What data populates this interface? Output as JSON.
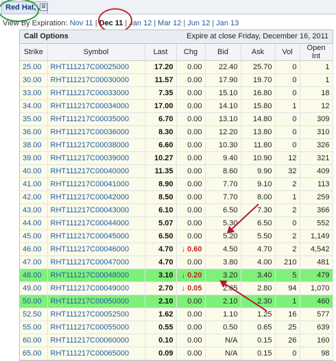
{
  "tab": {
    "label": "Red Hat, ...",
    "close": "⊠"
  },
  "expiration": {
    "label": "View By Expiration:",
    "links": [
      "Nov 11",
      "Dec 11",
      "Jan 12",
      "Mar 12",
      "Jun 12",
      "Jan 13"
    ],
    "current": "Dec 11"
  },
  "table": {
    "title": "Call Options",
    "expire_note": "Expire at close Friday, December 16, 2011",
    "columns": [
      "Strike",
      "Symbol",
      "Last",
      "Chg",
      "Bid",
      "Ask",
      "Vol",
      "Open Int"
    ],
    "rows": [
      [
        "25.00",
        "RHT111217C00025000",
        "17.20",
        "0.00",
        "22.40",
        "25.70",
        "0",
        "1"
      ],
      [
        "30.00",
        "RHT111217C00030000",
        "11.57",
        "0.00",
        "17.90",
        "19.70",
        "0",
        "1"
      ],
      [
        "33.00",
        "RHT111217C00033000",
        "7.35",
        "0.00",
        "15.10",
        "16.80",
        "0",
        "18"
      ],
      [
        "34.00",
        "RHT111217C00034000",
        "17.00",
        "0.00",
        "14.10",
        "15.80",
        "1",
        "12"
      ],
      [
        "35.00",
        "RHT111217C00035000",
        "6.70",
        "0.00",
        "13.10",
        "14.80",
        "0",
        "309"
      ],
      [
        "36.00",
        "RHT111217C00036000",
        "8.30",
        "0.00",
        "12.20",
        "13.80",
        "0",
        "310"
      ],
      [
        "38.00",
        "RHT111217C00038000",
        "6.60",
        "0.00",
        "10.30",
        "11.80",
        "0",
        "326"
      ],
      [
        "39.00",
        "RHT111217C00039000",
        "10.27",
        "0.00",
        "9.40",
        "10.90",
        "12",
        "321"
      ],
      [
        "40.00",
        "RHT111217C00040000",
        "11.35",
        "0.00",
        "8.60",
        "9.90",
        "32",
        "409"
      ],
      [
        "41.00",
        "RHT111217C00041000",
        "8.90",
        "0.00",
        "7.70",
        "9.10",
        "2",
        "113"
      ],
      [
        "42.00",
        "RHT111217C00042000",
        "8.50",
        "0.00",
        "7.70",
        "8.00",
        "1",
        "259"
      ],
      [
        "43.00",
        "RHT111217C00043000",
        "6.10",
        "0.00",
        "6.50",
        "7.30",
        "2",
        "366"
      ],
      [
        "44.00",
        "RHT111217C00044000",
        "5.07",
        "0.00",
        "5.30",
        "6.50",
        "0",
        "552"
      ],
      [
        "45.00",
        "RHT111217C00045000",
        "6.50",
        "0.00",
        "5.20",
        "5.50",
        "2",
        "1,149"
      ],
      [
        "46.00",
        "RHT111217C00046000",
        "4.70",
        "0.60",
        "4.50",
        "4.70",
        "2",
        "4,542"
      ],
      [
        "47.00",
        "RHT111217C00047000",
        "4.70",
        "0.00",
        "3.80",
        "4.00",
        "210",
        "481"
      ],
      [
        "48.00",
        "RHT111217C00048000",
        "3.10",
        "0.20",
        "3.20",
        "3.40",
        "5",
        "479"
      ],
      [
        "49.00",
        "RHT111217C00049000",
        "2.70",
        "0.05",
        "2.65",
        "2.80",
        "94",
        "1,070"
      ],
      [
        "50.00",
        "RHT111217C00050000",
        "2.10",
        "0.00",
        "2.10",
        "2.30",
        "1",
        "460"
      ],
      [
        "52.50",
        "RHT111217C00052500",
        "1.62",
        "0.00",
        "1.10",
        "1.25",
        "16",
        "577"
      ],
      [
        "55.00",
        "RHT111217C00055000",
        "0.55",
        "0.00",
        "0.50",
        "0.65",
        "25",
        "639"
      ],
      [
        "60.00",
        "RHT111217C00060000",
        "0.10",
        "0.00",
        "N/A",
        "0.15",
        "26",
        "160"
      ],
      [
        "65.00",
        "RHT111217C00065000",
        "0.09",
        "0.00",
        "N/A",
        "0.15",
        "0",
        "98"
      ]
    ],
    "down_rows": [
      14,
      16,
      17
    ],
    "highlight_rows": [
      16,
      18
    ],
    "down_glyph": "↓",
    "colors": {
      "highlight": "#7ff07a",
      "row_bg": "#fbfbe9",
      "link": "#1e5aa8",
      "down": "#c01f1f",
      "annotation_red": "#cc2a2a",
      "annotation_green": "#2f9a3a"
    }
  }
}
